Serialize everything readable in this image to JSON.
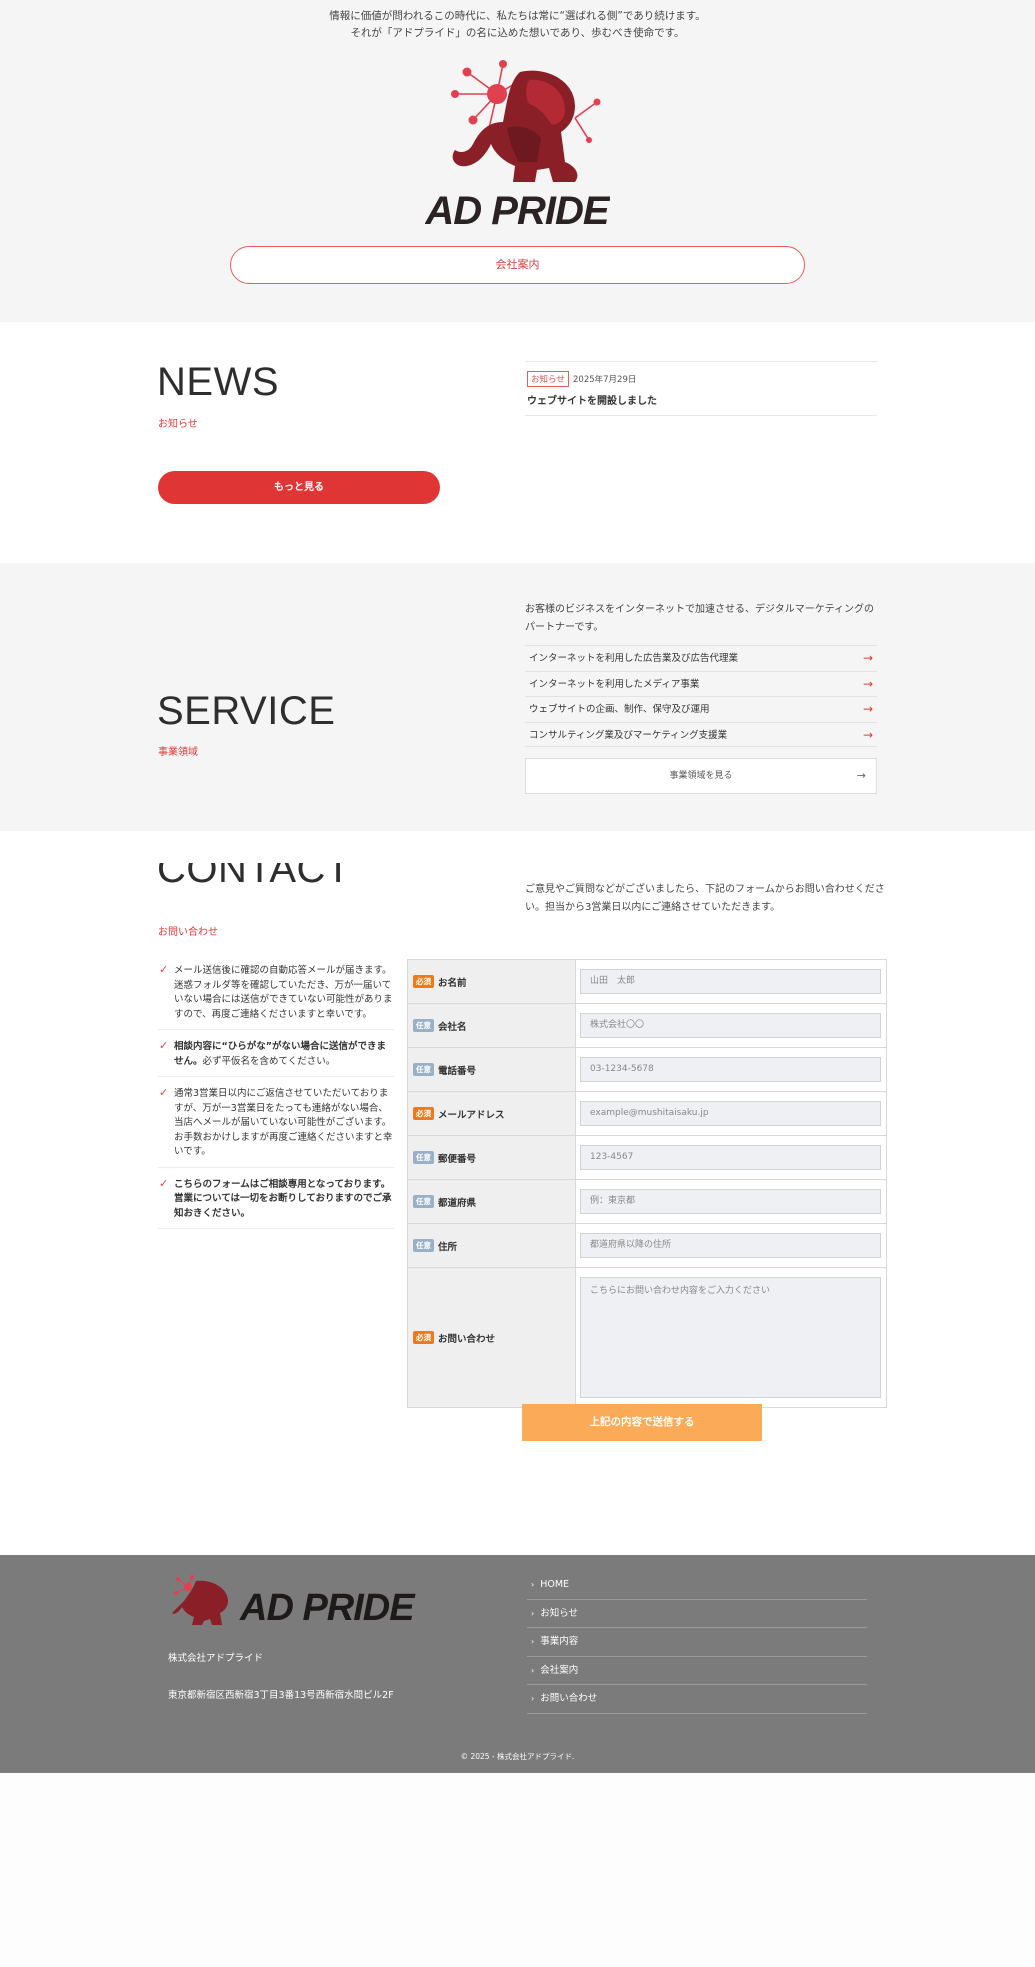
{
  "hero": {
    "line1": "情報に価値が問われるこの時代に、私たちは常に“選ばれる側”であり続けます。",
    "line2": "それが「アドプライド」の名に込めた想いであり、歩むべき使命です。",
    "logo_text": "AD PRIDE",
    "company_button": "会社案内"
  },
  "news": {
    "title": "NEWS",
    "subtitle": "お知らせ",
    "items": [
      {
        "tag": "お知らせ",
        "date": "2025年7月29日",
        "title": "ウェブサイトを開設しました"
      }
    ],
    "more_button": "もっと見る"
  },
  "service": {
    "title": "SERVICE",
    "subtitle": "事業領域",
    "intro": "お客様のビジネスをインターネットで加速させる、デジタルマーケティングのパートナーです。",
    "items": [
      "インターネットを利用した広告業及び広告代理業",
      "インターネットを利用したメディア事業",
      "ウェブサイトの企画、制作、保守及び運用",
      "コンサルティング業及びマーケティング支援業"
    ],
    "arrow": "→",
    "button": "事業領域を見る"
  },
  "contact": {
    "title": "CONTACT",
    "subtitle": "お問い合わせ",
    "intro": "ご意見やご質問などがございましたら、下記のフォームからお問い合わせください。担当から3営業日以内にご連絡させていただきます。",
    "notes": [
      {
        "bold": "",
        "text": "メール送信後に確認の自動応答メールが届きます。迷惑フォルダ等を確認していただき、万が一届いていない場合には送信ができていない可能性がありますので、再度ご連絡くださいますと幸いです。"
      },
      {
        "bold": "相談内容に“ひらがな”がない場合に送信ができません。",
        "text": "必ず平仮名を含めてください。"
      },
      {
        "bold": "",
        "text": "通常3営業日以内にご返信させていただいておりますが、万が一3営業日をたっても連絡がない場合、当店へメールが届いていない可能性がございます。お手数おかけしますが再度ご連絡くださいますと幸いです。"
      },
      {
        "bold": "こちらのフォームはご相談専用となっております。営業については一切をお断りしておりますのでご承知おきください。",
        "text": ""
      }
    ],
    "required_label": "必須",
    "optional_label": "任意",
    "fields": [
      {
        "label": "お名前",
        "required": true,
        "placeholder": "山田　太郎"
      },
      {
        "label": "会社名",
        "required": false,
        "placeholder": "株式会社〇〇"
      },
      {
        "label": "電話番号",
        "required": false,
        "placeholder": "03-1234-5678"
      },
      {
        "label": "メールアドレス",
        "required": true,
        "placeholder": "example@mushitaisaku.jp"
      },
      {
        "label": "郵便番号",
        "required": false,
        "placeholder": "123-4567"
      },
      {
        "label": "都道府県",
        "required": false,
        "placeholder": "例：東京都"
      },
      {
        "label": "住所",
        "required": false,
        "placeholder": "都道府県以降の住所"
      },
      {
        "label": "お問い合わせ",
        "required": true,
        "placeholder": "こちらにお問い合わせ内容をご入力ください",
        "multiline": true
      }
    ],
    "submit": "上記の内容で送信する"
  },
  "footer": {
    "logo_text": "AD PRIDE",
    "company": "株式会社アドプライド",
    "address": "東京都新宿区西新宿3丁目3番13号西新宿水間ビル2F",
    "nav": [
      "HOME",
      "お知らせ",
      "事業内容",
      "会社案内",
      "お問い合わせ"
    ],
    "copyright": "© 2025 - 株式会社アドプライド."
  },
  "colors": {
    "accent": "#e03535",
    "submit": "#fbaa58",
    "footer_bg": "#7b7b7b",
    "section_bg": "#f6f5f5"
  }
}
